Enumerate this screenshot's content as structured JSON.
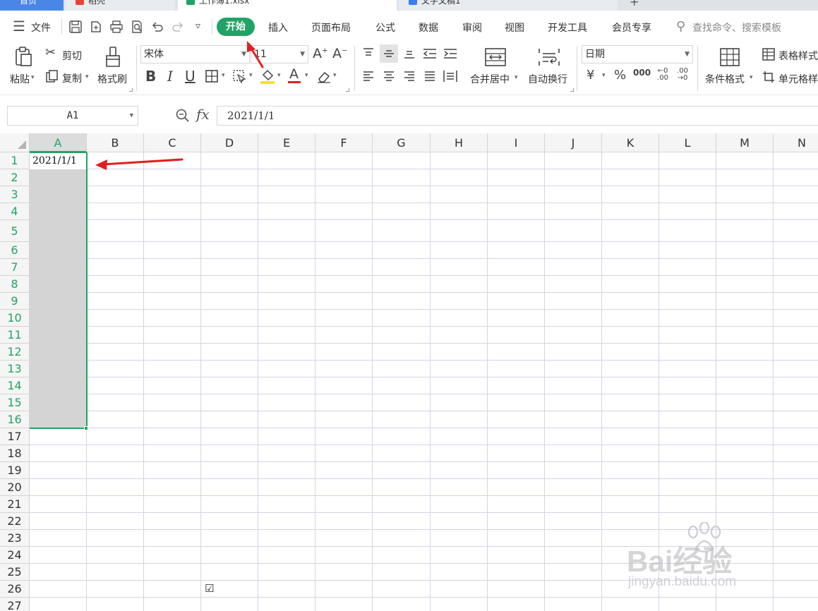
{
  "tabs": [
    {
      "label": "首页",
      "active": false
    },
    {
      "label": "稻壳",
      "active": false
    },
    {
      "label": "工作簿1.xlsx",
      "active": true
    },
    {
      "label": "文字文稿1",
      "active": false
    }
  ],
  "menu": {
    "file_label": "文件",
    "active_tab": "开始",
    "items": [
      "插入",
      "页面布局",
      "公式",
      "数据",
      "审阅",
      "视图",
      "开发工具",
      "会员专享"
    ],
    "search_placeholder": "查找命令、搜索模板"
  },
  "ribbon": {
    "paste": "粘贴",
    "cut": "剪切",
    "copy": "复制",
    "format_painter": "格式刷",
    "font_name": "宋体",
    "font_size": "11",
    "merge_center": "合并居中",
    "wrap_text": "自动换行",
    "number_format": "日期",
    "conditional_format": "条件格式",
    "table_style": "表格样式",
    "cell_format": "单元格样",
    "currency": "¥",
    "percent": "%",
    "thousands": "000",
    "dec_inc": "←0 .00",
    "dec_dec": ".00 →0"
  },
  "formula_bar": {
    "name_box": "A1",
    "content": "2021/1/1"
  },
  "sheet": {
    "columns": [
      "A",
      "B",
      "C",
      "D",
      "E",
      "F",
      "G",
      "H",
      "I",
      "J",
      "K",
      "L",
      "M",
      "N"
    ],
    "rows": [
      "1",
      "2",
      "3",
      "4",
      "5",
      "6",
      "7",
      "8",
      "9",
      "10",
      "11",
      "12",
      "13",
      "14",
      "15",
      "16",
      "17",
      "18",
      "19",
      "20",
      "21",
      "22",
      "23",
      "24",
      "25",
      "26",
      "27"
    ],
    "selected_column": "A",
    "selection": "A1:A16",
    "cell_A1": "2021/1/1",
    "checkbox_D26": "☑"
  },
  "watermark": {
    "brand": "Bai经验",
    "url": "jingyan.baidu.com"
  },
  "colors": {
    "accent_green": "#21a366",
    "annotation_red": "#e02020",
    "tab_blue": "#4a86e8"
  }
}
